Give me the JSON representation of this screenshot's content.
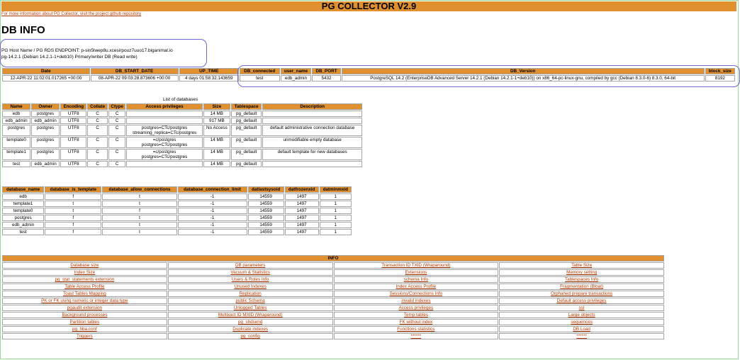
{
  "app": {
    "title": "PG COLLECTOR V2.9",
    "info_link": "For more information about PG Collector, visit the project github repository",
    "section_title": "DB INFO"
  },
  "host": {
    "line1": "PG Host Name / PG RDS ENDPOINT: p-sin5lwep8u.xcesirpouz7uuo17.biganimal.io",
    "line2": "pg-14.2.1 (Debian 14.2.1-1+deb10) Primary/writer DB (Read write)"
  },
  "db_info": {
    "headers": [
      "Date",
      "DB_START_DATE",
      "UP_TIME",
      "DB_connected",
      "user_name",
      "DB_PORT",
      "DB_Version",
      "block_size"
    ],
    "row": [
      "12-APR-22 11:02:01.017265 +00:00",
      "08-APR-22 09:03:28.873606 +00:00",
      "4 days 01:58:32.143659",
      "test",
      "edb_admin",
      "5432",
      "PostgreSQL 14.2 (EnterpriseDB Advanced Server 14.2.1 (Debian 14.2.1-1+deb10)) on x86_64-pc-linux-gnu, compiled by gcc (Debian 8.3.0-6) 8.3.0, 64-bit",
      "8192"
    ]
  },
  "databases": {
    "caption": "List of databases",
    "headers": [
      "Name",
      "Owner",
      "Encoding",
      "Collate",
      "Ctype",
      "Access privileges",
      "Size",
      "Tablespace",
      "Description"
    ],
    "rows": [
      [
        "edb",
        "postgres",
        "UTF8",
        "C",
        "C",
        "",
        "14 MB",
        "pg_default",
        ""
      ],
      [
        "edb_admin",
        "edb_admin",
        "UTF8",
        "C",
        "C",
        "",
        "917 MB",
        "pg_default",
        ""
      ],
      [
        "postgres",
        "postgres",
        "UTF8",
        "C",
        "C",
        "postgres=CTc/postgres\nstreaming_replica=CTc/postgres",
        "No Access",
        "pg_default",
        "default administrative connection database"
      ],
      [
        "template0",
        "postgres",
        "UTF8",
        "C",
        "C",
        "=c/postgres\npostgres=CTc/postgres",
        "14 MB",
        "pg_default",
        "unmodifiable empty database"
      ],
      [
        "template1",
        "postgres",
        "UTF8",
        "C",
        "C",
        "=c/postgres\npostgres=CTc/postgres",
        "14 MB",
        "pg_default",
        "default template for new databases"
      ],
      [
        "test",
        "edb_admin",
        "UTF8",
        "C",
        "C",
        "",
        "14 MB",
        "pg_default",
        ""
      ]
    ]
  },
  "db_stats": {
    "headers": [
      "database_name",
      "database_is_template",
      "database_allow_connections",
      "database_connection_limit",
      "datlastsysoid",
      "datfrozenxid",
      "datminmxid"
    ],
    "rows": [
      [
        "edb",
        "f",
        "t",
        "-1",
        "14559",
        "1497",
        "1"
      ],
      [
        "template1",
        "t",
        "t",
        "-1",
        "14559",
        "1497",
        "1"
      ],
      [
        "template0",
        "t",
        "f",
        "-1",
        "14559",
        "1497",
        "1"
      ],
      [
        "postgres",
        "f",
        "t",
        "-1",
        "14559",
        "1497",
        "1"
      ],
      [
        "edb_admin",
        "f",
        "t",
        "-1",
        "14559",
        "1497",
        "1"
      ],
      [
        "test",
        "f",
        "t",
        "-1",
        "14559",
        "1497",
        "1"
      ]
    ]
  },
  "info": {
    "title": "INFO",
    "rows": [
      [
        "Database size",
        "DB parameters",
        "Transaction ID TXID (Wraparound)",
        "Table Size"
      ],
      [
        "Index Size",
        "Vacuum & Statistics",
        "Extensions",
        "Memory setting"
      ],
      [
        "pg_stat_statements extension",
        "Users & Roles Info",
        "schema Info",
        "Tablespaces Info"
      ],
      [
        "Table Access Profile",
        "Unused Indexes",
        "Index Access Profile",
        "Fragmentation (Bloat)"
      ],
      [
        "Toast Tables Mapping",
        "Replication",
        "Sessions/Connections Info",
        "Orphaned prepare transactions"
      ],
      [
        "PK or FK using numeric or integer data type",
        "public Schema",
        "invalid indexes",
        "Default access privileges"
      ],
      [
        "pgaudit extension",
        "Unlogged Tables",
        "Access privileges",
        "ssl"
      ],
      [
        "Background processes",
        "Multixact ID MXID (Wraparound)",
        "Temp tables",
        "Large objects"
      ],
      [
        "Partition tables",
        "pg_shdsend",
        "FK without index",
        "sequences"
      ],
      [
        "pg_hba.conf",
        "Duplicate indexes",
        "Functions statistics",
        "DB Load"
      ],
      [
        "Triggers",
        "pg_config",
        "******",
        "******"
      ]
    ]
  },
  "colors": {
    "header": "#e0902f",
    "link": "#b33a00",
    "highlight": "#6e6ad0"
  }
}
